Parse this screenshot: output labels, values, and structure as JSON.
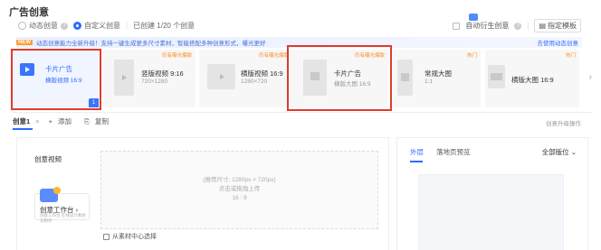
{
  "header": {
    "title": "广告创意"
  },
  "mode": {
    "option_dynamic": "动态创意",
    "option_custom": "自定义创意",
    "created_count": "已创建 1/20 个创意"
  },
  "tools": {
    "derive_label": "自动衍生创意",
    "template_label": "指定模板"
  },
  "notice": {
    "tag": "NEW",
    "text": "动态创意能力全新升级！支持一键生成更多尺寸素材，智能搭配多种创意形式，曝光更好",
    "link": "去使用动态创意"
  },
  "templates": [
    {
      "tag": "",
      "name": "卡片广告",
      "sub": "横版视频 16:9",
      "selected": true,
      "num": "1"
    },
    {
      "tag": "仍有曝光爆款",
      "name": "竖版视频 9:16",
      "sub": "720×1280",
      "selected": false
    },
    {
      "tag": "仍有曝光爆款",
      "name": "横版视频 16:9",
      "sub": "1280×720",
      "selected": false
    },
    {
      "tag": "仍有曝光爆款",
      "name": "卡片广告",
      "sub": "横版大图 16:9",
      "selected": false
    },
    {
      "tag": "热门",
      "name": "常规大图",
      "sub": "1:1",
      "selected": false
    },
    {
      "tag": "热门",
      "name": "横版大图 16:9",
      "sub": "",
      "selected": false
    }
  ],
  "editor": {
    "tab_active": "创意1",
    "tab_add": "添加",
    "tab_copy": "复制",
    "right_link": "创意升级操作",
    "video_label": "创意视频",
    "upload_size": "(推荐尺寸: 1280px × 720px)",
    "upload_action": "点击或拖拽上传",
    "upload_ratio": "16 : 9",
    "workbench_title": "创意工作台",
    "workbench_sub": "创意工作台 在线设计素材与制作",
    "library": "从素材中心选择"
  },
  "preview": {
    "tab_outer": "外层",
    "tab_landing": "落地页预览",
    "placement": "全部版位"
  },
  "colors": {
    "accent": "#2f6bff",
    "highlight": "#e03b2f",
    "hot": "#ff8a1f"
  }
}
